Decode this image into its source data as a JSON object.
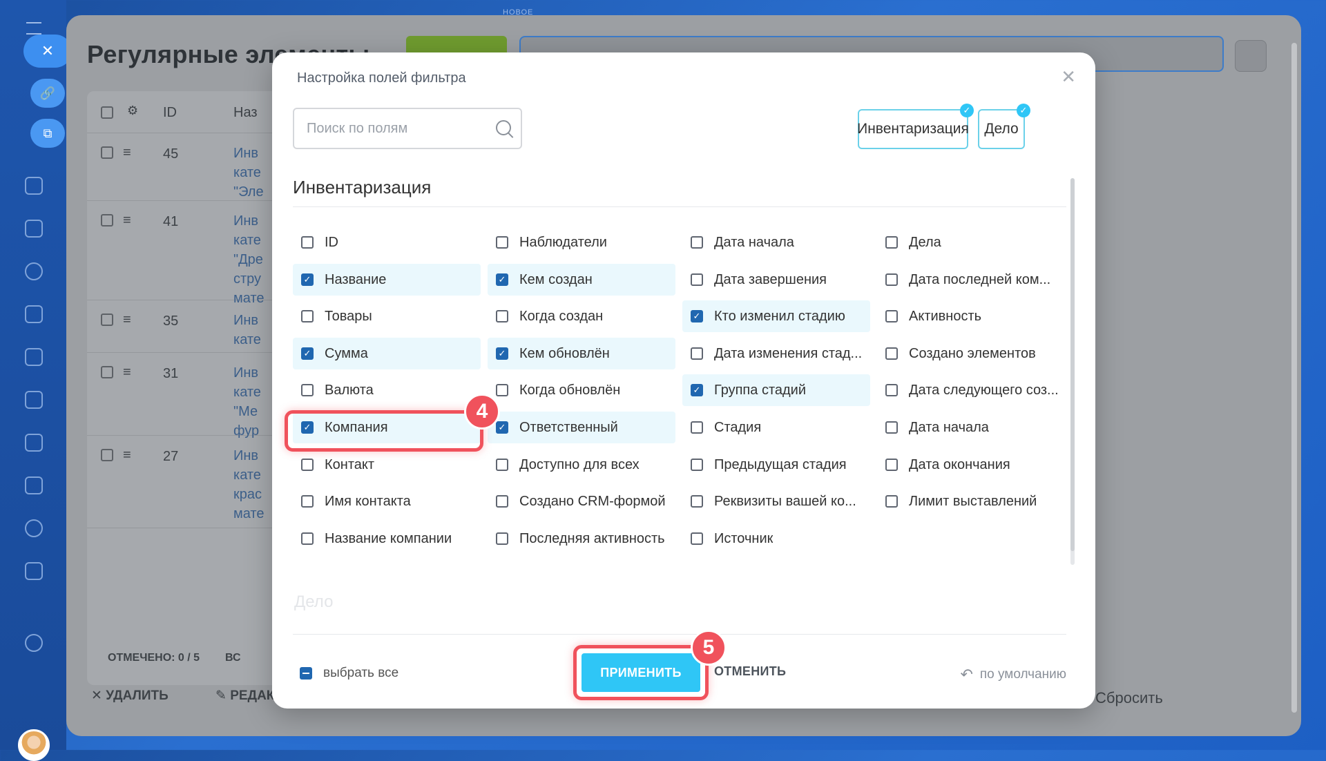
{
  "background": {
    "top_label": "НОВОЕ",
    "app_title": "Регулярные элементы",
    "table": {
      "header": {
        "id": "ID",
        "name": "Наз"
      },
      "rows": [
        {
          "id": "45",
          "text": "Инв\nкате\n\"Эле"
        },
        {
          "id": "41",
          "text": "Инв\nкате\n\"Дре\nстру\nмате"
        },
        {
          "id": "35",
          "text": "Инв\nкате"
        },
        {
          "id": "31",
          "text": "Инв\nкате\n\"Ме\nфур"
        },
        {
          "id": "27",
          "text": "Инв\nкате\nкрас\nмате"
        }
      ],
      "selected_label": "ОТМЕЧЕНО:",
      "selected_value": "0 / 5",
      "total_label": "ВС",
      "delete_label": "УДАЛИТЬ",
      "edit_label": "РЕДАК"
    },
    "reset_label": "Сбросить"
  },
  "modal": {
    "title": "Настройка полей фильтра",
    "search_placeholder": "Поиск по полям",
    "tags": [
      "Инвентаризация",
      "Дело"
    ],
    "section_title": "Инвентаризация",
    "next_section_title": "Дело",
    "columns": [
      [
        {
          "label": "ID",
          "checked": false
        },
        {
          "label": "Название",
          "checked": true
        },
        {
          "label": "Товары",
          "checked": false
        },
        {
          "label": "Сумма",
          "checked": true
        },
        {
          "label": "Валюта",
          "checked": false
        },
        {
          "label": "Компания",
          "checked": true
        },
        {
          "label": "Контакт",
          "checked": false
        },
        {
          "label": "Имя контакта",
          "checked": false
        },
        {
          "label": "Название компании",
          "checked": false
        }
      ],
      [
        {
          "label": "Наблюдатели",
          "checked": false
        },
        {
          "label": "Кем создан",
          "checked": true
        },
        {
          "label": "Когда создан",
          "checked": false
        },
        {
          "label": "Кем обновлён",
          "checked": true
        },
        {
          "label": "Когда обновлён",
          "checked": false
        },
        {
          "label": "Ответственный",
          "checked": true
        },
        {
          "label": "Доступно для всех",
          "checked": false
        },
        {
          "label": "Создано CRM-формой",
          "checked": false
        },
        {
          "label": "Последняя активность",
          "checked": false
        }
      ],
      [
        {
          "label": "Дата начала",
          "checked": false
        },
        {
          "label": "Дата завершения",
          "checked": false
        },
        {
          "label": "Кто изменил стадию",
          "checked": true
        },
        {
          "label": "Дата изменения стад...",
          "checked": false
        },
        {
          "label": "Группа стадий",
          "checked": true
        },
        {
          "label": "Стадия",
          "checked": false
        },
        {
          "label": "Предыдущая стадия",
          "checked": false
        },
        {
          "label": "Реквизиты вашей ко...",
          "checked": false
        },
        {
          "label": "Источник",
          "checked": false
        }
      ],
      [
        {
          "label": "Дела",
          "checked": false
        },
        {
          "label": "Дата последней ком...",
          "checked": false
        },
        {
          "label": "Активность",
          "checked": false
        },
        {
          "label": "Создано элементов",
          "checked": false
        },
        {
          "label": "Дата следующего соз...",
          "checked": false
        },
        {
          "label": "Дата начала",
          "checked": false
        },
        {
          "label": "Дата окончания",
          "checked": false
        },
        {
          "label": "Лимит выставлений",
          "checked": false
        }
      ]
    ],
    "select_all_label": "выбрать все",
    "apply_label": "ПРИМЕНИТЬ",
    "cancel_label": "ОТМЕНИТЬ",
    "default_label": "по умолчанию"
  },
  "callouts": {
    "step_company": "4",
    "step_apply": "5"
  },
  "colors": {
    "accent": "#2fc6f6",
    "checkbox": "#2067b0",
    "highlight": "#f0525c"
  }
}
